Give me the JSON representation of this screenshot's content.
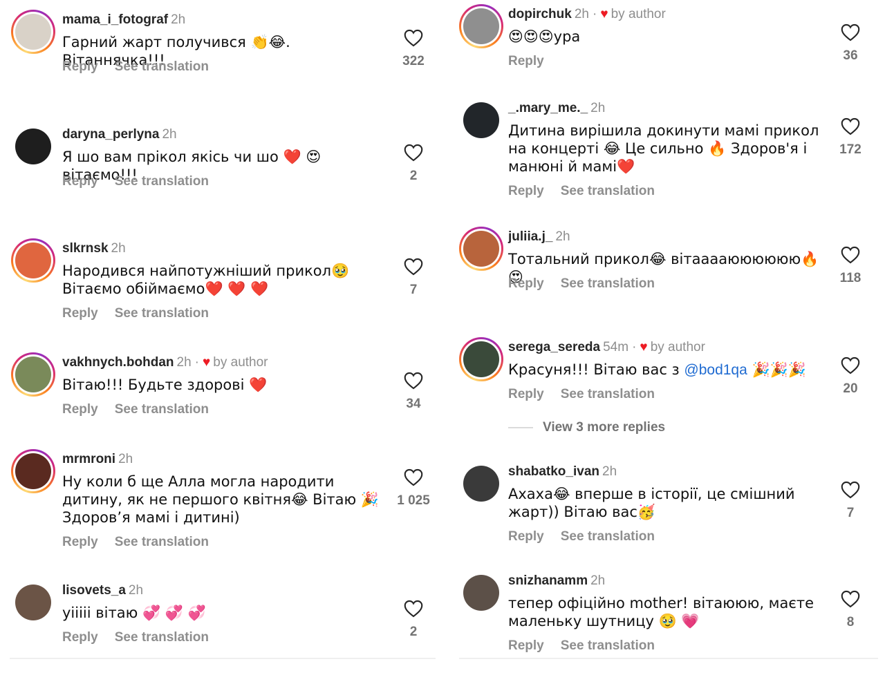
{
  "comments_left": [
    {
      "username": "mama_i_fotograf",
      "time": "2h",
      "by_author": false,
      "text": "Гарний жарт получився 👏😂. Вітаннячка!!!",
      "likes": "322",
      "reply_label": "Reply",
      "translate_label": "See translation",
      "avatar_color": "#d9d2c8"
    },
    {
      "username": "daryna_perlyna",
      "time": "2h",
      "by_author": false,
      "text": "Я шо вам прікол якісь чи шо ❤️ 😍 вітаємо!!!",
      "likes": "2",
      "reply_label": "Reply",
      "translate_label": "See translation",
      "avatar_color": "#1e1e1e"
    },
    {
      "username": "slkrnsk",
      "time": "2h",
      "by_author": false,
      "text": "Народився найпотужніший прикол🥹 Вітаємо обіймаємо❤️ ❤️ ❤️",
      "likes": "7",
      "reply_label": "Reply",
      "translate_label": "See translation",
      "avatar_color": "#e0663f"
    },
    {
      "username": "vakhnych.bohdan",
      "time": "2h",
      "by_author": true,
      "by_author_label": "by author",
      "text": "Вітаю!!! Будьте здорові ❤️",
      "likes": "34",
      "reply_label": "Reply",
      "translate_label": "See translation",
      "avatar_color": "#7a8a5a"
    },
    {
      "username": "mrmroni",
      "time": "2h",
      "by_author": false,
      "text": "Ну коли б ще Алла могла народити дитину, як не першого квітня😂 Вітаю 🎉 Здоров’я мамі і дитині)",
      "likes": "1 025",
      "reply_label": "Reply",
      "translate_label": "See translation",
      "avatar_color": "#5a2a20"
    },
    {
      "username": "lisovets_a",
      "time": "2h",
      "by_author": false,
      "text": "уііііі вітаю 💞 💞 💞",
      "likes": "2",
      "reply_label": "Reply",
      "translate_label": "See translation",
      "avatar_color": "#6b5446"
    }
  ],
  "comments_right": [
    {
      "username": "dopirchuk",
      "time": "2h",
      "by_author": true,
      "by_author_label": "by author",
      "text": "😍😍😍ура",
      "likes": "36",
      "reply_label": "Reply",
      "translate_label": "",
      "avatar_color": "#8f8f8f"
    },
    {
      "username": "_.mary_me._",
      "time": "2h",
      "by_author": false,
      "text": "Дитина вирішила докинути мамі прикол на концерті 😂 Це сильно 🔥 Здоров'я і манюні й мамі❤️",
      "likes": "172",
      "reply_label": "Reply",
      "translate_label": "See translation",
      "avatar_color": "#22262a"
    },
    {
      "username": "juliia.j_",
      "time": "2h",
      "by_author": false,
      "text": "Тотальний прикол😂 вітааааюююююю🔥😍",
      "likes": "118",
      "reply_label": "Reply",
      "translate_label": "See translation",
      "avatar_color": "#b8643c"
    },
    {
      "username": "serega_sereda",
      "time": "54m",
      "by_author": true,
      "by_author_label": "by author",
      "text_before": "Красуня!!! Вітаю вас з ",
      "mention": "@bod1qa",
      "text_after": " 🎉🎉🎉",
      "likes": "20",
      "reply_label": "Reply",
      "translate_label": "See translation",
      "view_replies": "View 3 more replies",
      "avatar_color": "#3a4a3a"
    },
    {
      "username": "shabatko_ivan",
      "time": "2h",
      "by_author": false,
      "text": "Ахаха😂 вперше в історії, це смішний жарт)) Вітаю вас🥳",
      "likes": "7",
      "reply_label": "Reply",
      "translate_label": "See translation",
      "avatar_color": "#3a3a3a"
    },
    {
      "username": "snizhanamm",
      "time": "2h",
      "by_author": false,
      "text": "тепер офіційно mother! вітаююю, маєте маленьку шутницу 🥹 💗",
      "likes": "8",
      "reply_label": "Reply",
      "translate_label": "See translation",
      "avatar_color": "#5c5048"
    }
  ],
  "icons": {
    "like": "heart-outline-icon",
    "author_heart": "heart-filled-icon"
  },
  "colors": {
    "username": "#262626",
    "muted": "#8e8e8e",
    "heart": "#ed1c24",
    "mention": "#1f6bd1"
  }
}
